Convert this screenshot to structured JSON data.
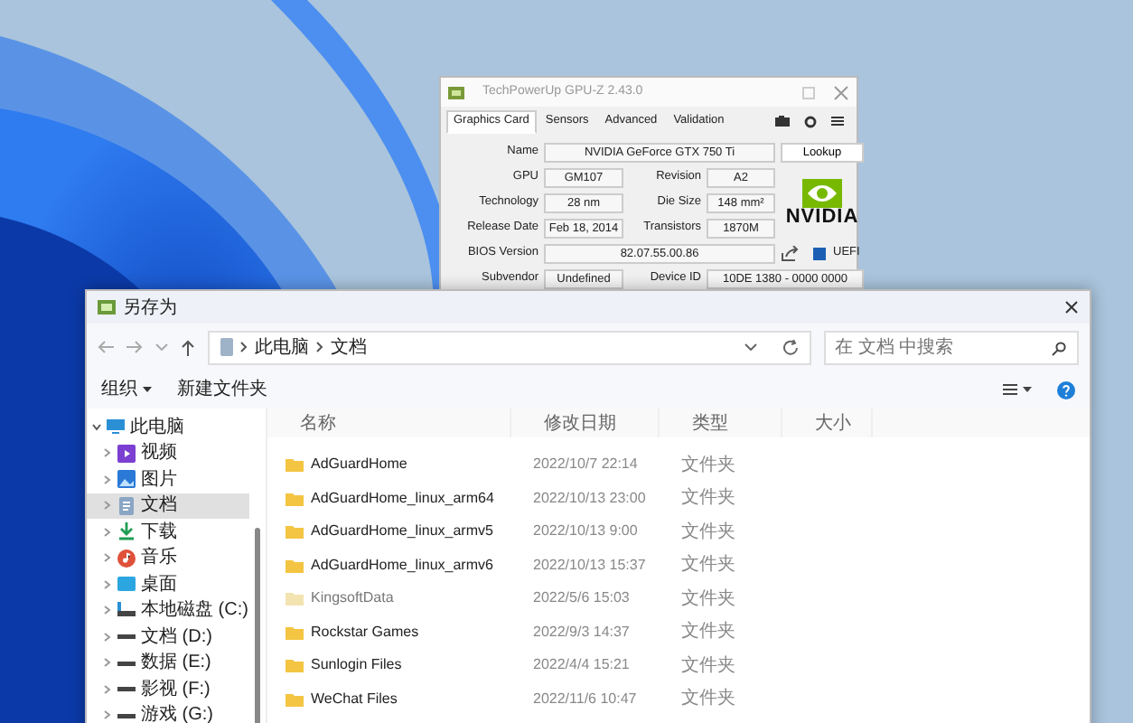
{
  "gpuz": {
    "title": "TechPowerUp GPU-Z 2.43.0",
    "tabs": [
      {
        "label": "Graphics Card",
        "selected": true
      },
      {
        "label": "Sensors",
        "selected": false
      },
      {
        "label": "Advanced",
        "selected": false
      },
      {
        "label": "Validation",
        "selected": false
      }
    ],
    "lookup_button": "Lookup",
    "logo_text": "NVIDIA",
    "rows": [
      {
        "cells": [
          {
            "label": "Name",
            "value": "NVIDIA GeForce GTX 750 Ti"
          }
        ]
      },
      {
        "cells": [
          {
            "label": "GPU",
            "value": "GM107"
          },
          {
            "label": "Revision",
            "value": "A2"
          }
        ]
      },
      {
        "cells": [
          {
            "label": "Technology",
            "value": "28 nm"
          },
          {
            "label": "Die Size",
            "value": "148 mm²"
          }
        ]
      },
      {
        "cells": [
          {
            "label": "Release Date",
            "value": "Feb 18, 2014"
          },
          {
            "label": "Transistors",
            "value": "1870M"
          }
        ]
      },
      {
        "cells": [
          {
            "label": "BIOS Version",
            "value": "82.07.55.00.86"
          }
        ]
      },
      {
        "cells": [
          {
            "label": "Subvendor",
            "value": "Undefined"
          },
          {
            "label": "Device ID",
            "value": "10DE 1380 - 0000 0000"
          }
        ]
      }
    ],
    "uefi": {
      "label": "UEFI",
      "checked": true
    }
  },
  "dialog": {
    "title": "另存为",
    "breadcrumb": [
      "此电脑",
      "文档"
    ],
    "search": {
      "placeholder": "在 文档 中搜索"
    },
    "toolbar": {
      "organize": "组织",
      "new_folder": "新建文件夹"
    },
    "sidebar": [
      {
        "label": "此电脑",
        "kind": "pc",
        "expanded": true,
        "selected": false,
        "children": [
          {
            "label": "视频",
            "kind": "video",
            "expanded": false,
            "selected": false
          },
          {
            "label": "图片",
            "kind": "picture",
            "expanded": false,
            "selected": false
          },
          {
            "label": "文档",
            "kind": "doc",
            "expanded": false,
            "selected": true
          },
          {
            "label": "下载",
            "kind": "download",
            "expanded": false,
            "selected": false
          },
          {
            "label": "音乐",
            "kind": "music",
            "expanded": false,
            "selected": false
          },
          {
            "label": "桌面",
            "kind": "desktop",
            "expanded": false,
            "selected": false
          },
          {
            "label": "本地磁盘 (C:)",
            "kind": "system-drive",
            "expanded": false,
            "selected": false
          },
          {
            "label": "文档 (D:)",
            "kind": "drive",
            "expanded": false,
            "selected": false
          },
          {
            "label": "数据 (E:)",
            "kind": "drive",
            "expanded": false,
            "selected": false
          },
          {
            "label": "影视 (F:)",
            "kind": "drive",
            "expanded": false,
            "selected": false
          },
          {
            "label": "游戏 (G:)",
            "kind": "drive",
            "expanded": false,
            "selected": false
          }
        ]
      }
    ],
    "columns": [
      "名称",
      "修改日期",
      "类型",
      "大小"
    ],
    "files": [
      {
        "name": "AdGuardHome",
        "modified": "2022/10/7 22:14",
        "type": "文件夹",
        "hidden": false
      },
      {
        "name": "AdGuardHome_linux_arm64",
        "modified": "2022/10/13 23:00",
        "type": "文件夹",
        "hidden": false
      },
      {
        "name": "AdGuardHome_linux_armv5",
        "modified": "2022/10/13 9:00",
        "type": "文件夹",
        "hidden": false
      },
      {
        "name": "AdGuardHome_linux_armv6",
        "modified": "2022/10/13 15:37",
        "type": "文件夹",
        "hidden": false
      },
      {
        "name": "KingsoftData",
        "modified": "2022/5/6 15:03",
        "type": "文件夹",
        "hidden": true
      },
      {
        "name": "Rockstar Games",
        "modified": "2022/9/3 14:37",
        "type": "文件夹",
        "hidden": false
      },
      {
        "name": "Sunlogin Files",
        "modified": "2022/4/4 15:21",
        "type": "文件夹",
        "hidden": false
      },
      {
        "name": "WeChat Files",
        "modified": "2022/11/6 10:47",
        "type": "文件夹",
        "hidden": false
      }
    ]
  }
}
